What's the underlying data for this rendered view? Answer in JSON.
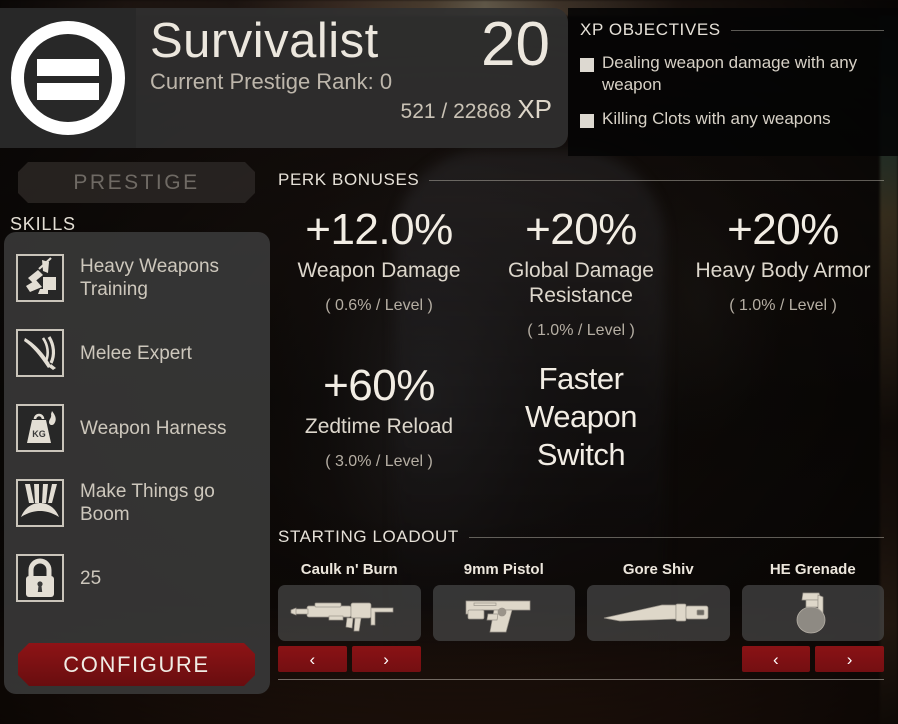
{
  "header": {
    "perk_logo_icon": "survivalist-perk-icon",
    "perk_name": "Survivalist",
    "prestige_line": "Current Prestige Rank: 0",
    "level": "20",
    "xp_current_max": "521 / 22868",
    "xp_unit": "XP"
  },
  "xp_objectives": {
    "title": "XP OBJECTIVES",
    "items": [
      {
        "label": "Dealing weapon damage with any weapon",
        "checked": false
      },
      {
        "label": "Killing Clots with any weapons",
        "checked": false
      }
    ]
  },
  "sidebar": {
    "prestige_button": "PRESTIGE",
    "prestige_enabled": false,
    "skills_label": "SKILLS",
    "skills": [
      {
        "label": "Heavy Weapons Training",
        "icon": "heavy-weapons-training-icon"
      },
      {
        "label": "Melee Expert",
        "icon": "melee-expert-icon"
      },
      {
        "label": "Weapon Harness",
        "icon": "weapon-harness-icon"
      },
      {
        "label": "Make Things go Boom",
        "icon": "make-things-go-boom-icon"
      },
      {
        "label": "25",
        "icon": "lock-icon"
      }
    ],
    "configure_button": "CONFIGURE"
  },
  "perk_bonuses": {
    "title": "PERK BONUSES",
    "items": [
      {
        "value": "+12.0%",
        "label": "Weapon Damage",
        "per_level": "( 0.6% / Level )"
      },
      {
        "value": "+20%",
        "label": "Global Damage Resistance",
        "per_level": "( 1.0% / Level )"
      },
      {
        "value": "+20%",
        "label": "Heavy Body Armor",
        "per_level": "( 1.0% / Level )"
      },
      {
        "value": "+60%",
        "label": "Zedtime Reload",
        "per_level": "( 3.0% / Level )"
      },
      {
        "value": "Faster Weapon Switch",
        "label": "",
        "per_level": ""
      }
    ]
  },
  "starting_loadout": {
    "title": "STARTING LOADOUT",
    "items": [
      {
        "name": "Caulk n' Burn",
        "icon": "flamethrower-icon",
        "has_arrows": true,
        "prev": "‹",
        "next": "›"
      },
      {
        "name": "9mm Pistol",
        "icon": "pistol-icon",
        "has_arrows": false,
        "prev": "‹",
        "next": "›"
      },
      {
        "name": "Gore Shiv",
        "icon": "knife-icon",
        "has_arrows": false,
        "prev": "‹",
        "next": "›"
      },
      {
        "name": "HE Grenade",
        "icon": "grenade-icon",
        "has_arrows": true,
        "prev": "‹",
        "next": "›"
      }
    ]
  },
  "colors": {
    "accent_red": "#8a1215",
    "panel_grey": "#3a3a3a",
    "header_grey": "#2f2f2f",
    "text_cream": "#ece7de",
    "text_muted": "#b5aea3"
  }
}
